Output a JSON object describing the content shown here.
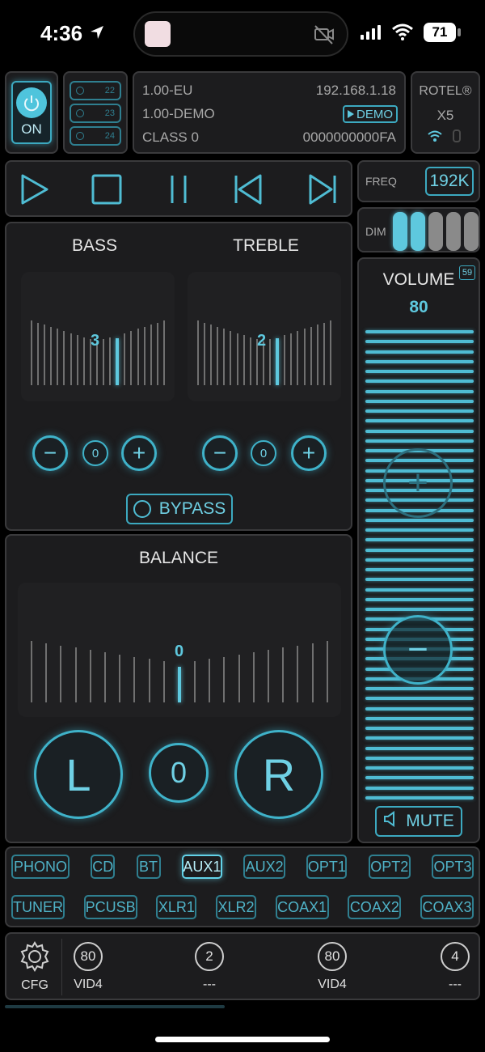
{
  "status_bar": {
    "time": "4:36",
    "battery": "71"
  },
  "power": {
    "label": "ON"
  },
  "zones": [
    {
      "value": "22"
    },
    {
      "value": "23"
    },
    {
      "value": "24"
    }
  ],
  "device_info": {
    "region": "1.00-EU",
    "ip": "192.168.1.18",
    "mode": "1.00-DEMO",
    "demo_badge": "DEMO",
    "class": "CLASS 0",
    "serial": "0000000000FA"
  },
  "model": {
    "brand": "ROTEL®",
    "name": "X5"
  },
  "freq": {
    "label": "FREQ",
    "value": "192K"
  },
  "dim": {
    "label": "DIM",
    "level": 2,
    "total": 5
  },
  "bass": {
    "label": "BASS",
    "value": "3",
    "zero": "0"
  },
  "treble": {
    "label": "TREBLE",
    "value": "2",
    "zero": "0"
  },
  "bypass": {
    "label": "BYPASS"
  },
  "balance": {
    "label": "BALANCE",
    "value": "0",
    "left": "L",
    "center": "0",
    "right": "R"
  },
  "volume": {
    "label": "VOLUME",
    "badge": "59",
    "value": "80",
    "mute": "MUTE"
  },
  "sources_row1": [
    "PHONO",
    "CD",
    "BT",
    "AUX1",
    "AUX2",
    "OPT1",
    "OPT2",
    "OPT3"
  ],
  "sources_row2": [
    "TUNER",
    "PCUSB",
    "XLR1",
    "XLR2",
    "COAX1",
    "COAX2",
    "COAX3"
  ],
  "active_source": "AUX1",
  "bottom": {
    "cfg": "CFG",
    "items": [
      {
        "num": "80",
        "label": "VID4"
      },
      {
        "num": "2",
        "label": "---"
      },
      {
        "num": "80",
        "label": "VID4"
      },
      {
        "num": "4",
        "label": "---"
      }
    ]
  },
  "colors": {
    "accent": "#4fbcd3",
    "panel": "#1c1c1e",
    "border": "#3a3a3c"
  }
}
